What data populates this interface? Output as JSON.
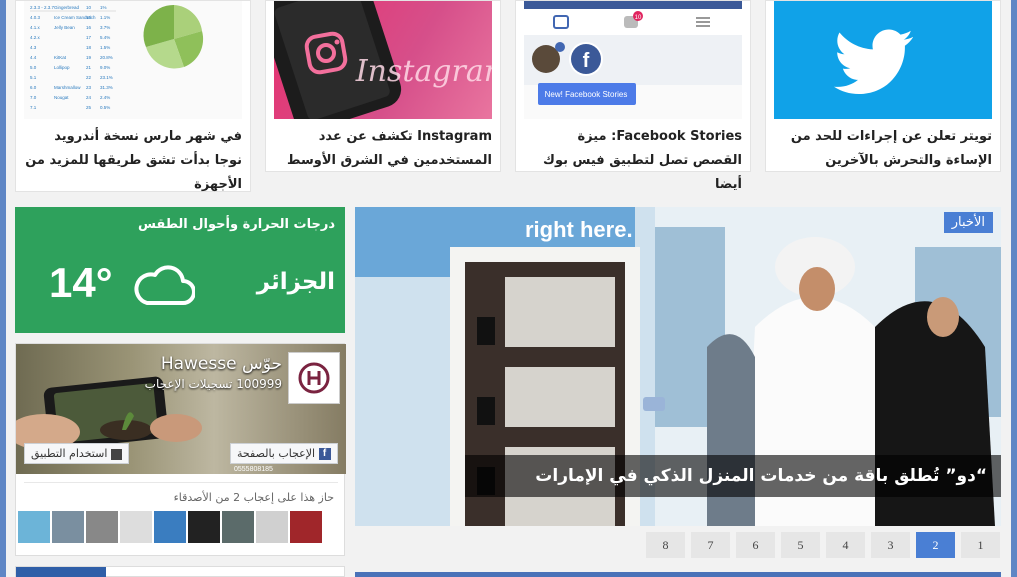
{
  "articles": [
    {
      "title": "تويتر تعلن عن إجراءات للحد من الإساءة والتحرش بالآخرين",
      "thumb": "twitter-bird-icon"
    },
    {
      "title": "Facebook Stories: ميزة القصص تصل لتطبيق فيس بوك أيضا",
      "thumb": "facebook-app-screenshot",
      "tip": "New! Facebook Stories",
      "notif": "10"
    },
    {
      "title": "Instagram تكشف عن عدد المستخدمين في الشرق الأوسط",
      "thumb": "instagram-phone-photo",
      "brand": "Instagram"
    },
    {
      "title": "في شهر مارس نسخة أندرويد نوجا بدأت تشق طريقها للمزيد من الأجهزة",
      "thumb": "android-distribution-chart"
    }
  ],
  "android_table": [
    [
      "2.3.3 - 2.3.7",
      "Gingerbread",
      "10",
      "1%"
    ],
    [
      "4.0.3",
      "Ice Cream Sandwich",
      "15",
      "1.1%"
    ],
    [
      "4.1.x",
      "Jelly Bean",
      "16",
      "3.7%"
    ],
    [
      "4.2.x",
      "",
      "17",
      "5.4%"
    ],
    [
      "4.3",
      "",
      "18",
      "1.5%"
    ],
    [
      "4.4",
      "KitKat",
      "19",
      "20.8%"
    ],
    [
      "5.0",
      "Lollipop",
      "21",
      "9.0%"
    ],
    [
      "5.1",
      "",
      "22",
      "23.1%"
    ],
    [
      "6.0",
      "Marshmallow",
      "23",
      "31.3%"
    ],
    [
      "7.0",
      "Nougat",
      "24",
      "2.4%"
    ],
    [
      "7.1",
      "",
      "25",
      "0.5%"
    ]
  ],
  "weather": {
    "title": "درجات الحرارة وأحوال الطقس",
    "city": "الجزائر",
    "temp": "14°",
    "icon": "cloud-icon"
  },
  "facebook": {
    "page_name": "Hawesse حوّس",
    "likes": "100999 تسجيلات الإعجاب",
    "like_button": "الإعجاب بالصفحة",
    "app_button": "استخدام التطبيق",
    "friends_text": "حاز هذا على إعجاب 2 من الأصدقاء",
    "phone": "0555808185"
  },
  "slider": {
    "category": "الأخبار",
    "headline": "“دو” تُطلق باقة من خدمات المنزل الذكي في الإمارات",
    "sign_text": "right here."
  },
  "pager": {
    "pages": [
      "1",
      "2",
      "3",
      "4",
      "5",
      "6",
      "7",
      "8"
    ],
    "active": "2"
  },
  "colors": {
    "accent": "#4a7fd4",
    "weather": "#2ea15c",
    "twitter": "#10a2e8",
    "background": "#5f86c5"
  }
}
